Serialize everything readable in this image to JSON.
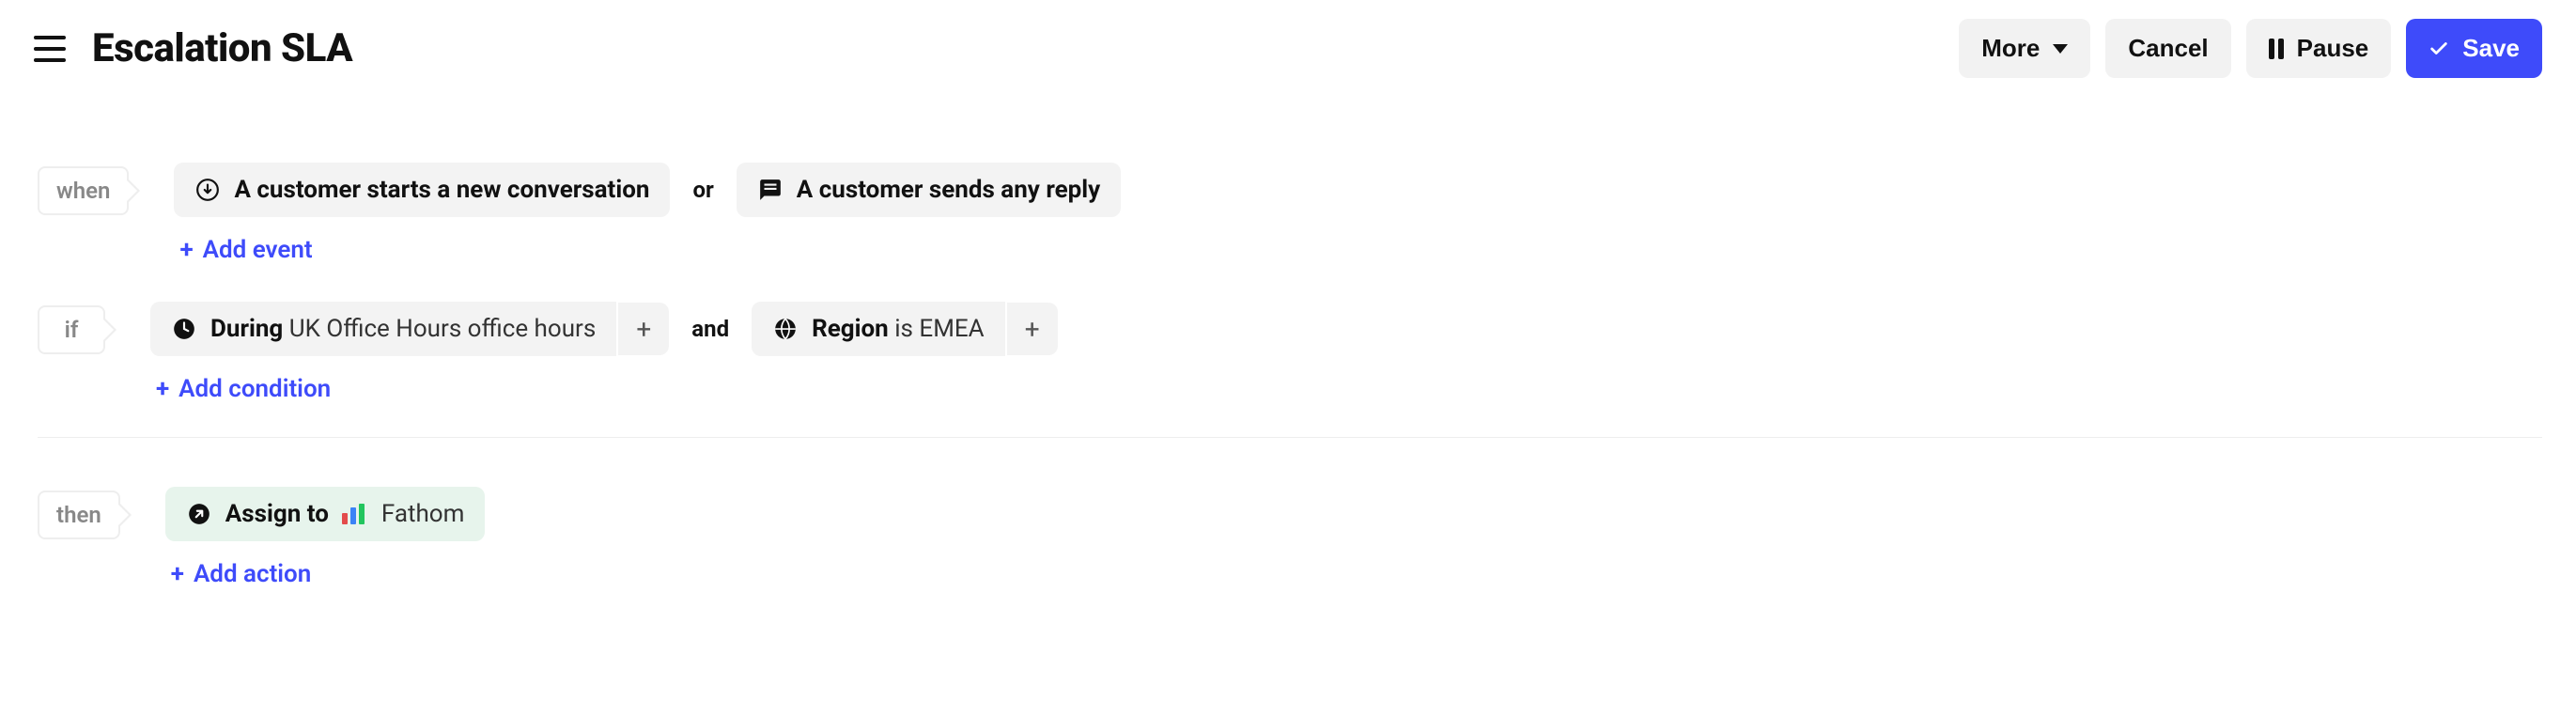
{
  "header": {
    "title": "Escalation SLA",
    "buttons": {
      "more": "More",
      "cancel": "Cancel",
      "pause": "Pause",
      "save": "Save"
    }
  },
  "sections": {
    "when": {
      "label": "when",
      "events": [
        {
          "text": "A customer starts a new conversation"
        },
        {
          "text": "A customer sends any reply"
        }
      ],
      "connector": "or",
      "add_link": "Add event"
    },
    "if": {
      "label": "if",
      "conditions": [
        {
          "prefix": "During",
          "value": "UK Office Hours office hours"
        },
        {
          "prefix": "Region",
          "middle": "is",
          "value": "EMEA"
        }
      ],
      "connector": "and",
      "add_link": "Add condition"
    },
    "then": {
      "label": "then",
      "actions": [
        {
          "prefix": "Assign to",
          "target": "Fathom"
        }
      ],
      "add_link": "Add action"
    }
  }
}
